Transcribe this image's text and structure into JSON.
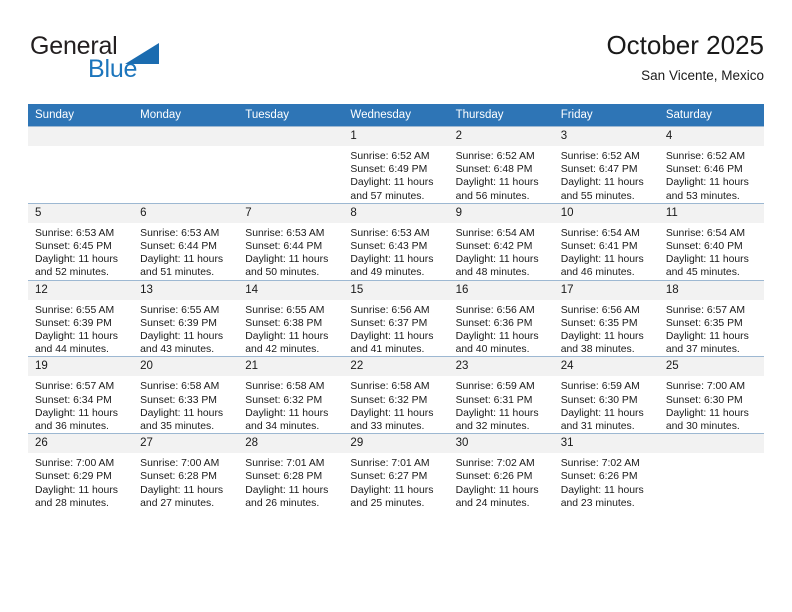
{
  "logo": {
    "word_one": "General",
    "word_two": "Blue",
    "colors": {
      "dark": "#231f20",
      "blue": "#1c75bc",
      "triangle": "#1b6cb0"
    }
  },
  "header": {
    "title": "October 2025",
    "location": "San Vicente, Mexico"
  },
  "theme": {
    "header_bg": "#2e75b6",
    "daynum_bg": "#f2f2f2",
    "grid_line": "#9db8d2",
    "text": "#1a1a1a"
  },
  "weekdays": [
    "Sunday",
    "Monday",
    "Tuesday",
    "Wednesday",
    "Thursday",
    "Friday",
    "Saturday"
  ],
  "labels": {
    "sunrise_prefix": "Sunrise:",
    "sunset_prefix": "Sunset:",
    "daylight_prefix": "Daylight:"
  },
  "weeks": [
    [
      {
        "day": "",
        "sunrise": "",
        "sunset": "",
        "daylight_line1": "",
        "daylight_line2": ""
      },
      {
        "day": "",
        "sunrise": "",
        "sunset": "",
        "daylight_line1": "",
        "daylight_line2": ""
      },
      {
        "day": "",
        "sunrise": "",
        "sunset": "",
        "daylight_line1": "",
        "daylight_line2": ""
      },
      {
        "day": "1",
        "sunrise": "Sunrise: 6:52 AM",
        "sunset": "Sunset: 6:49 PM",
        "daylight_line1": "Daylight: 11 hours",
        "daylight_line2": "and 57 minutes."
      },
      {
        "day": "2",
        "sunrise": "Sunrise: 6:52 AM",
        "sunset": "Sunset: 6:48 PM",
        "daylight_line1": "Daylight: 11 hours",
        "daylight_line2": "and 56 minutes."
      },
      {
        "day": "3",
        "sunrise": "Sunrise: 6:52 AM",
        "sunset": "Sunset: 6:47 PM",
        "daylight_line1": "Daylight: 11 hours",
        "daylight_line2": "and 55 minutes."
      },
      {
        "day": "4",
        "sunrise": "Sunrise: 6:52 AM",
        "sunset": "Sunset: 6:46 PM",
        "daylight_line1": "Daylight: 11 hours",
        "daylight_line2": "and 53 minutes."
      }
    ],
    [
      {
        "day": "5",
        "sunrise": "Sunrise: 6:53 AM",
        "sunset": "Sunset: 6:45 PM",
        "daylight_line1": "Daylight: 11 hours",
        "daylight_line2": "and 52 minutes."
      },
      {
        "day": "6",
        "sunrise": "Sunrise: 6:53 AM",
        "sunset": "Sunset: 6:44 PM",
        "daylight_line1": "Daylight: 11 hours",
        "daylight_line2": "and 51 minutes."
      },
      {
        "day": "7",
        "sunrise": "Sunrise: 6:53 AM",
        "sunset": "Sunset: 6:44 PM",
        "daylight_line1": "Daylight: 11 hours",
        "daylight_line2": "and 50 minutes."
      },
      {
        "day": "8",
        "sunrise": "Sunrise: 6:53 AM",
        "sunset": "Sunset: 6:43 PM",
        "daylight_line1": "Daylight: 11 hours",
        "daylight_line2": "and 49 minutes."
      },
      {
        "day": "9",
        "sunrise": "Sunrise: 6:54 AM",
        "sunset": "Sunset: 6:42 PM",
        "daylight_line1": "Daylight: 11 hours",
        "daylight_line2": "and 48 minutes."
      },
      {
        "day": "10",
        "sunrise": "Sunrise: 6:54 AM",
        "sunset": "Sunset: 6:41 PM",
        "daylight_line1": "Daylight: 11 hours",
        "daylight_line2": "and 46 minutes."
      },
      {
        "day": "11",
        "sunrise": "Sunrise: 6:54 AM",
        "sunset": "Sunset: 6:40 PM",
        "daylight_line1": "Daylight: 11 hours",
        "daylight_line2": "and 45 minutes."
      }
    ],
    [
      {
        "day": "12",
        "sunrise": "Sunrise: 6:55 AM",
        "sunset": "Sunset: 6:39 PM",
        "daylight_line1": "Daylight: 11 hours",
        "daylight_line2": "and 44 minutes."
      },
      {
        "day": "13",
        "sunrise": "Sunrise: 6:55 AM",
        "sunset": "Sunset: 6:39 PM",
        "daylight_line1": "Daylight: 11 hours",
        "daylight_line2": "and 43 minutes."
      },
      {
        "day": "14",
        "sunrise": "Sunrise: 6:55 AM",
        "sunset": "Sunset: 6:38 PM",
        "daylight_line1": "Daylight: 11 hours",
        "daylight_line2": "and 42 minutes."
      },
      {
        "day": "15",
        "sunrise": "Sunrise: 6:56 AM",
        "sunset": "Sunset: 6:37 PM",
        "daylight_line1": "Daylight: 11 hours",
        "daylight_line2": "and 41 minutes."
      },
      {
        "day": "16",
        "sunrise": "Sunrise: 6:56 AM",
        "sunset": "Sunset: 6:36 PM",
        "daylight_line1": "Daylight: 11 hours",
        "daylight_line2": "and 40 minutes."
      },
      {
        "day": "17",
        "sunrise": "Sunrise: 6:56 AM",
        "sunset": "Sunset: 6:35 PM",
        "daylight_line1": "Daylight: 11 hours",
        "daylight_line2": "and 38 minutes."
      },
      {
        "day": "18",
        "sunrise": "Sunrise: 6:57 AM",
        "sunset": "Sunset: 6:35 PM",
        "daylight_line1": "Daylight: 11 hours",
        "daylight_line2": "and 37 minutes."
      }
    ],
    [
      {
        "day": "19",
        "sunrise": "Sunrise: 6:57 AM",
        "sunset": "Sunset: 6:34 PM",
        "daylight_line1": "Daylight: 11 hours",
        "daylight_line2": "and 36 minutes."
      },
      {
        "day": "20",
        "sunrise": "Sunrise: 6:58 AM",
        "sunset": "Sunset: 6:33 PM",
        "daylight_line1": "Daylight: 11 hours",
        "daylight_line2": "and 35 minutes."
      },
      {
        "day": "21",
        "sunrise": "Sunrise: 6:58 AM",
        "sunset": "Sunset: 6:32 PM",
        "daylight_line1": "Daylight: 11 hours",
        "daylight_line2": "and 34 minutes."
      },
      {
        "day": "22",
        "sunrise": "Sunrise: 6:58 AM",
        "sunset": "Sunset: 6:32 PM",
        "daylight_line1": "Daylight: 11 hours",
        "daylight_line2": "and 33 minutes."
      },
      {
        "day": "23",
        "sunrise": "Sunrise: 6:59 AM",
        "sunset": "Sunset: 6:31 PM",
        "daylight_line1": "Daylight: 11 hours",
        "daylight_line2": "and 32 minutes."
      },
      {
        "day": "24",
        "sunrise": "Sunrise: 6:59 AM",
        "sunset": "Sunset: 6:30 PM",
        "daylight_line1": "Daylight: 11 hours",
        "daylight_line2": "and 31 minutes."
      },
      {
        "day": "25",
        "sunrise": "Sunrise: 7:00 AM",
        "sunset": "Sunset: 6:30 PM",
        "daylight_line1": "Daylight: 11 hours",
        "daylight_line2": "and 30 minutes."
      }
    ],
    [
      {
        "day": "26",
        "sunrise": "Sunrise: 7:00 AM",
        "sunset": "Sunset: 6:29 PM",
        "daylight_line1": "Daylight: 11 hours",
        "daylight_line2": "and 28 minutes."
      },
      {
        "day": "27",
        "sunrise": "Sunrise: 7:00 AM",
        "sunset": "Sunset: 6:28 PM",
        "daylight_line1": "Daylight: 11 hours",
        "daylight_line2": "and 27 minutes."
      },
      {
        "day": "28",
        "sunrise": "Sunrise: 7:01 AM",
        "sunset": "Sunset: 6:28 PM",
        "daylight_line1": "Daylight: 11 hours",
        "daylight_line2": "and 26 minutes."
      },
      {
        "day": "29",
        "sunrise": "Sunrise: 7:01 AM",
        "sunset": "Sunset: 6:27 PM",
        "daylight_line1": "Daylight: 11 hours",
        "daylight_line2": "and 25 minutes."
      },
      {
        "day": "30",
        "sunrise": "Sunrise: 7:02 AM",
        "sunset": "Sunset: 6:26 PM",
        "daylight_line1": "Daylight: 11 hours",
        "daylight_line2": "and 24 minutes."
      },
      {
        "day": "31",
        "sunrise": "Sunrise: 7:02 AM",
        "sunset": "Sunset: 6:26 PM",
        "daylight_line1": "Daylight: 11 hours",
        "daylight_line2": "and 23 minutes."
      },
      {
        "day": "",
        "sunrise": "",
        "sunset": "",
        "daylight_line1": "",
        "daylight_line2": ""
      }
    ]
  ]
}
